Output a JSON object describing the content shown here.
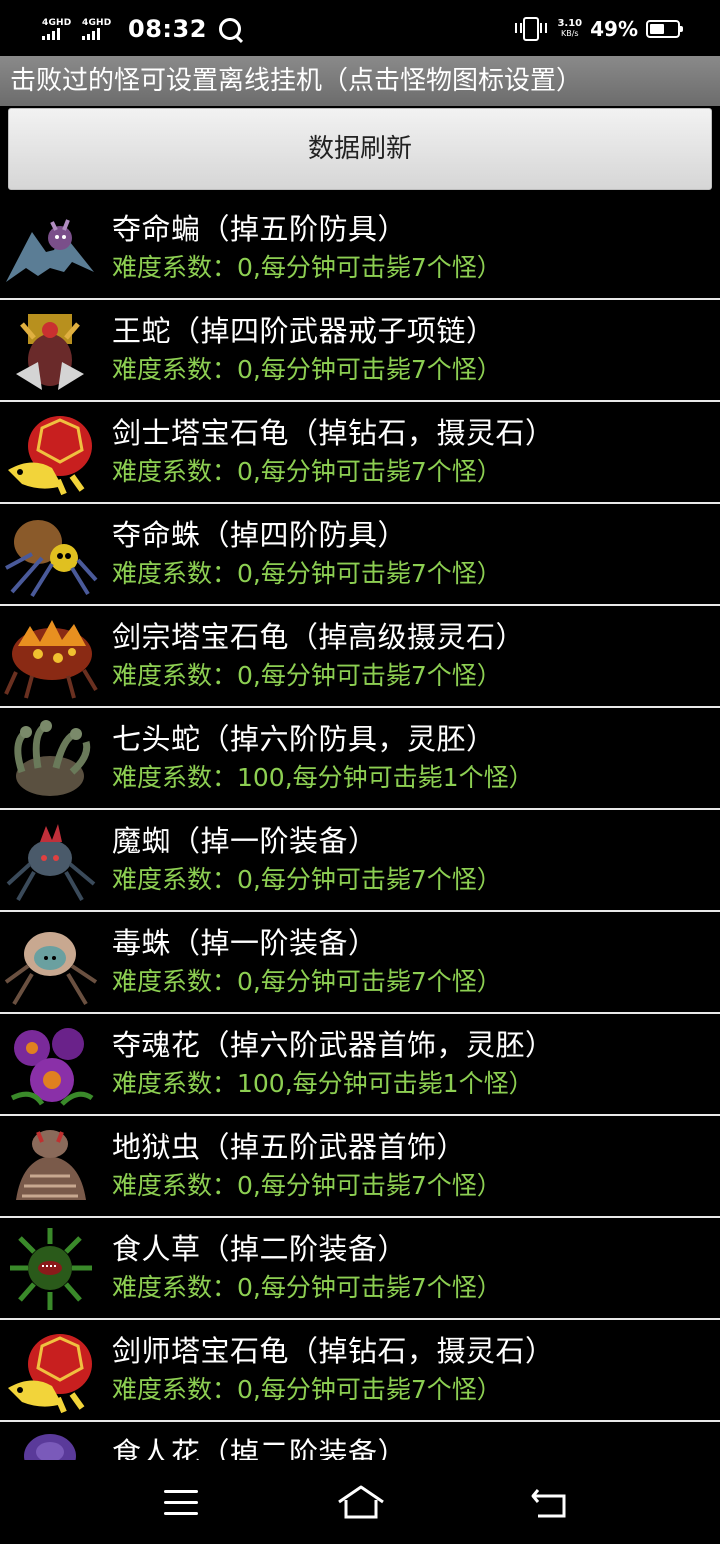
{
  "status_bar": {
    "network1": "4GHD",
    "network2": "4GHD",
    "time": "08:32",
    "speed_value": "3.10",
    "speed_unit": "KB/s",
    "battery": "49%"
  },
  "title": "击败过的怪可设置离线挂机（点击怪物图标设置）",
  "refresh_label": "数据刷新",
  "monsters": [
    {
      "name": "夺命蝙（掉五阶防具）",
      "info": "难度系数：0,每分钟可击毙7个怪）",
      "icon": "bat-icon"
    },
    {
      "name": "王蛇（掉四阶武器戒子项链）",
      "info": "难度系数：0,每分钟可击毙7个怪）",
      "icon": "serpent-king-icon"
    },
    {
      "name": "剑士塔宝石龟（掉钻石，摄灵石）",
      "info": "难度系数：0,每分钟可击毙7个怪）",
      "icon": "gem-turtle-icon"
    },
    {
      "name": "夺命蛛（掉四阶防具）",
      "info": "难度系数：0,每分钟可击毙7个怪）",
      "icon": "spider-icon"
    },
    {
      "name": "剑宗塔宝石龟（掉高级摄灵石）",
      "info": "难度系数：0,每分钟可击毙7个怪）",
      "icon": "lava-turtle-icon"
    },
    {
      "name": "七头蛇（掉六阶防具，灵胚）",
      "info": "难度系数：100,每分钟可击毙1个怪）",
      "icon": "hydra-icon"
    },
    {
      "name": "魔蜘（掉一阶装备）",
      "info": "难度系数：0,每分钟可击毙7个怪）",
      "icon": "demon-spider-icon"
    },
    {
      "name": "毒蛛（掉一阶装备）",
      "info": "难度系数：0,每分钟可击毙7个怪）",
      "icon": "poison-spider-icon"
    },
    {
      "name": "夺魂花（掉六阶武器首饰，灵胚）",
      "info": "难度系数：100,每分钟可击毙1个怪）",
      "icon": "soul-flower-icon"
    },
    {
      "name": "地狱虫（掉五阶武器首饰）",
      "info": "难度系数：0,每分钟可击毙7个怪）",
      "icon": "hell-worm-icon"
    },
    {
      "name": "食人草（掉二阶装备）",
      "info": "难度系数：0,每分钟可击毙7个怪）",
      "icon": "maneater-grass-icon"
    },
    {
      "name": "剑师塔宝石龟（掉钻石，摄灵石）",
      "info": "难度系数：0,每分钟可击毙7个怪）",
      "icon": "gem-turtle-icon"
    },
    {
      "name": "食人花（掉二阶装备）",
      "info": "",
      "icon": "maneater-flower-icon"
    }
  ],
  "colors": {
    "info_text": "#8dcf52",
    "title_bar": "#7a7a7a",
    "separator": "#e8e8e8"
  }
}
